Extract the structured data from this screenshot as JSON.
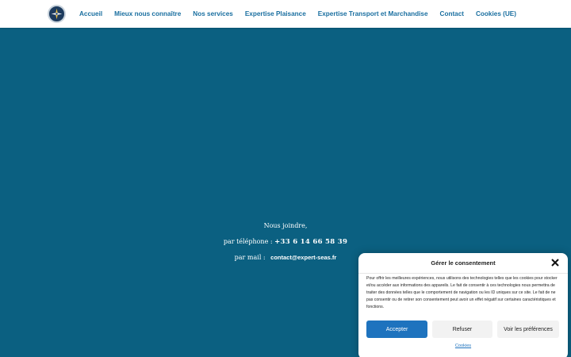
{
  "colors": {
    "background": "#0b6081",
    "nav_link": "#1a6fa0",
    "accept_button": "#1e73be",
    "header_bg": "#ffffff"
  },
  "header": {
    "logo_icon": "compass-rose-icon",
    "nav": [
      {
        "label": "Accueil"
      },
      {
        "label": "Mieux nous connaître"
      },
      {
        "label": "Nos services"
      },
      {
        "label": "Expertise Plaisance"
      },
      {
        "label": "Expertise Transport et Marchandise"
      },
      {
        "label": "Contact"
      },
      {
        "label": "Cookies (UE)"
      }
    ]
  },
  "contact": {
    "heading": "Nous joindre,",
    "phone_prefix": "par téléphone : ",
    "phone": "+33 6 14 66 58 39",
    "mail_prefix": "par mail : ",
    "email": "contact@expert-seas.fr"
  },
  "consent": {
    "title": "Gérer le consentement",
    "close_icon": "close-icon",
    "text": "Pour offrir les meilleures expériences, nous utilisons des technologies telles que les cookies pour stocker et/ou accéder aux informations des appareils. Le fait de consentir à ces technologies nous permettra de traiter des données telles que le comportement de navigation ou les ID uniques sur ce site. Le fait de ne pas consentir ou de retirer son consentement peut avoir un effet négatif sur certaines caractéristiques et fonctions.",
    "accept_label": "Accepter",
    "refuse_label": "Refuser",
    "prefs_label": "Voir les préférences",
    "cookies_link": "Cookies"
  }
}
